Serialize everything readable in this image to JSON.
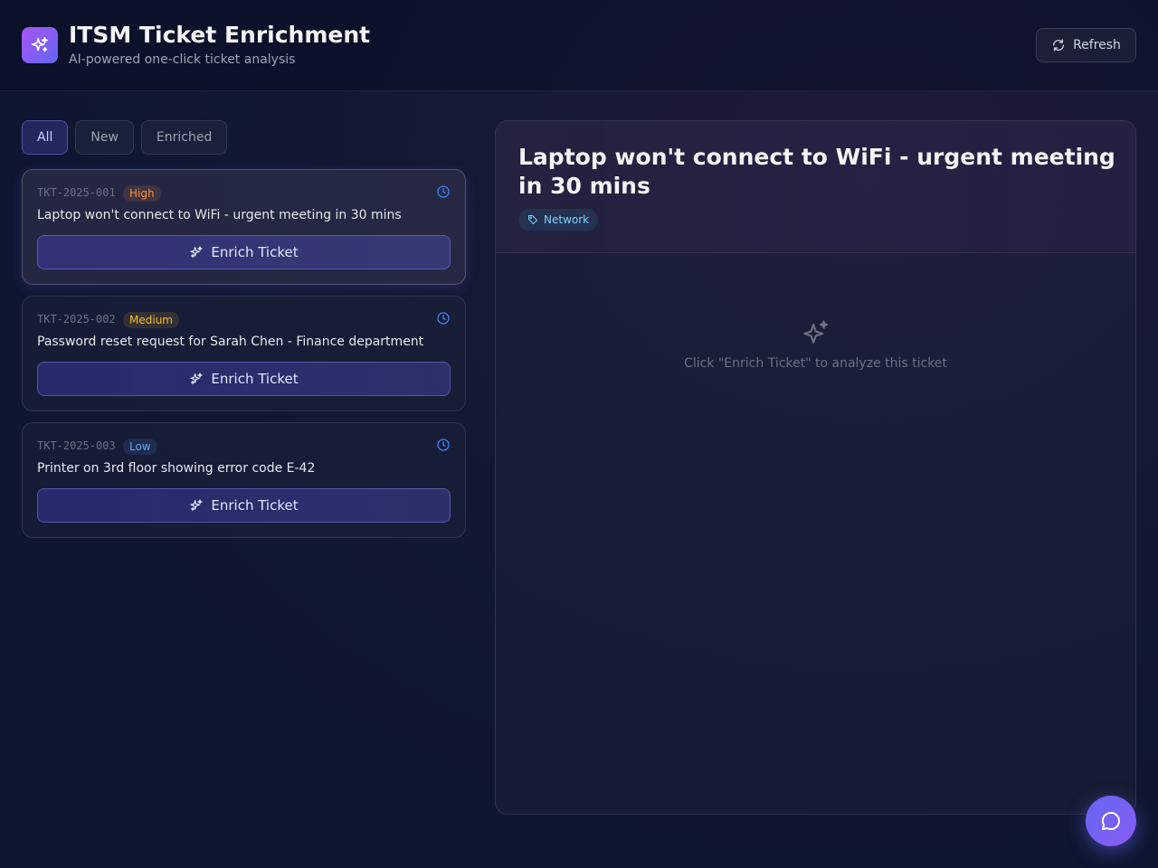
{
  "header": {
    "title": "ITSM Ticket Enrichment",
    "subtitle": "AI-powered one-click ticket analysis",
    "refresh_label": "Refresh"
  },
  "filters": [
    {
      "label": "All",
      "active": true
    },
    {
      "label": "New",
      "active": false
    },
    {
      "label": "Enriched",
      "active": false
    }
  ],
  "tickets": [
    {
      "id": "TKT-2025-001",
      "priority": "High",
      "title": "Laptop won't connect to WiFi - urgent meeting in 30 mins",
      "button_label": "Enrich Ticket",
      "selected": true
    },
    {
      "id": "TKT-2025-002",
      "priority": "Medium",
      "title": "Password reset request for Sarah Chen - Finance department",
      "button_label": "Enrich Ticket",
      "selected": false
    },
    {
      "id": "TKT-2025-003",
      "priority": "Low",
      "title": "Printer on 3rd floor showing error code E-42",
      "button_label": "Enrich Ticket",
      "selected": false
    }
  ],
  "detail": {
    "title": "Laptop won't connect to WiFi - urgent meeting in 30 mins",
    "category": "Network",
    "empty_message": "Click \"Enrich Ticket\" to analyze this ticket"
  },
  "icons": {
    "logo": "sparkles-icon",
    "refresh": "refresh-icon",
    "clock": "clock-icon",
    "enrich": "sparkles-icon",
    "tag": "tag-icon",
    "chat": "chat-bubble-icon"
  },
  "colors": {
    "accent": "#6366f1",
    "high": "#fb923c",
    "medium": "#fbbf24",
    "low": "#60a5fa",
    "tag": "#7dd3fc"
  }
}
